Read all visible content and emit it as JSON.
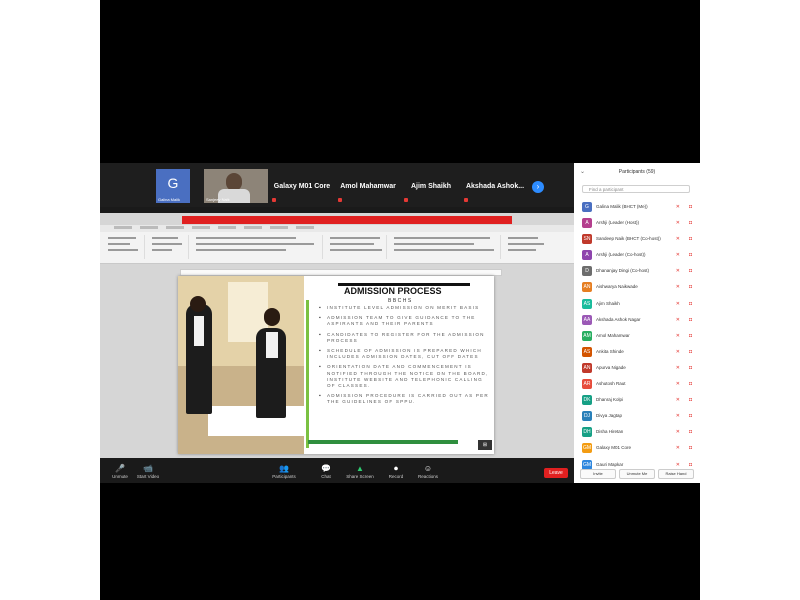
{
  "meeting": {
    "video_strip": {
      "tiles": [
        {
          "kind": "avatar",
          "letter": "G",
          "caption": "Galina Malik"
        },
        {
          "kind": "camera",
          "caption": "Sanjeev Naik"
        },
        {
          "kind": "name",
          "label": "Galaxy M01 Core"
        },
        {
          "kind": "name",
          "label": "Amol Mahamwar"
        },
        {
          "kind": "name",
          "label": "Ajim Shaikh"
        },
        {
          "kind": "name",
          "label": "Akshada Ashok..."
        }
      ],
      "next_arrow": "›"
    }
  },
  "slide": {
    "title": "ADMISSION PROCESS",
    "subtitle": "BBCHS",
    "bullets": [
      "Institute level admission on merit basis",
      "Admission team to give guidance to the aspirants and their parents",
      "Candidates to register for the admission process",
      "Schedule of admission is prepared which includes admission dates, cut off dates",
      "Orientation date and commencement is notified through the notice on the board, institute website and telephonic calling of classes.",
      "Admission procedure is carried out as per the guidelines of SPPU."
    ],
    "page_icon": "⊞"
  },
  "toolbar": {
    "buttons": [
      {
        "label": "Unmute",
        "icon": "🎤"
      },
      {
        "label": "Start Video",
        "icon": "📹"
      },
      {
        "label": "Participants",
        "icon": "👥"
      },
      {
        "label": "Chat",
        "icon": "💬"
      },
      {
        "label": "Share Screen",
        "icon": "▲"
      },
      {
        "label": "Record",
        "icon": "⏺"
      },
      {
        "label": "Reactions",
        "icon": "☺"
      }
    ],
    "leave_label": "Leave"
  },
  "participants_panel": {
    "title": "Participants (59)",
    "collapse": "⌄",
    "search_placeholder": "Find a participant",
    "participants": [
      {
        "initials": "G",
        "name": "Galina Malik (BHCT (Me))",
        "color": "#4a6fc1"
      },
      {
        "initials": "A",
        "name": "Arshji (Leader (Host))",
        "color": "#b43f8e"
      },
      {
        "initials": "SN",
        "name": "Sandeep Naik (BHCT (Co-host))",
        "color": "#c0392b"
      },
      {
        "initials": "A",
        "name": "Arshji (Leader (Co-host))",
        "color": "#8e44ad"
      },
      {
        "initials": "D",
        "name": "Dhananjay Dingi (Co-host)",
        "color": "#6d6d6d"
      },
      {
        "initials": "AN",
        "name": "Aishwarya Naikwade",
        "color": "#e67e22"
      },
      {
        "initials": "AS",
        "name": "Ajim Shaikh",
        "color": "#1abc9c"
      },
      {
        "initials": "AA",
        "name": "Akshada Ashok Nagar",
        "color": "#9b59b6"
      },
      {
        "initials": "AM",
        "name": "Amol Mahamwar",
        "color": "#27ae60"
      },
      {
        "initials": "AS",
        "name": "Ankita Shinde",
        "color": "#d35400"
      },
      {
        "initials": "AN",
        "name": "Apurva Nigade",
        "color": "#c0392b"
      },
      {
        "initials": "AR",
        "name": "Ashutosh Raut",
        "color": "#e74c3c"
      },
      {
        "initials": "DK",
        "name": "Dhanraj Kolpi",
        "color": "#16a085"
      },
      {
        "initials": "DJ",
        "name": "Divya Jagtap",
        "color": "#2980b9"
      },
      {
        "initials": "DH",
        "name": "Disha Hiretan",
        "color": "#16a085"
      },
      {
        "initials": "GM",
        "name": "Galaxy M01 Core",
        "color": "#f39c12"
      },
      {
        "initials": "GM",
        "name": "Gauri Mapkar",
        "color": "#2e86de"
      }
    ],
    "buttons": [
      "Invite",
      "Unmute Me",
      "Raise Hand"
    ]
  }
}
